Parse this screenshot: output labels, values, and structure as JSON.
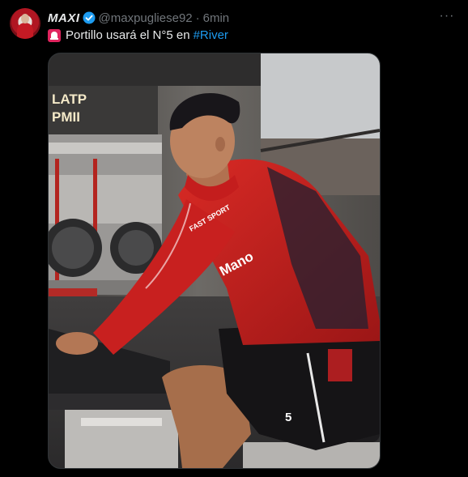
{
  "tweet": {
    "display_name": "MAXI",
    "handle": "@maxpugliese92",
    "separator": "·",
    "time": "6min",
    "text_main": "Portillo usará el N°5 en",
    "hashtag": "#River",
    "more_label": "···"
  },
  "media": {
    "gym_sign_top": "LATP",
    "gym_sign_bottom": "PMII",
    "jersey_sponsor": "Mano",
    "jersey_sleeve": "FAST SPORT",
    "shorts_number": "5"
  },
  "colors": {
    "background": "#000000",
    "text": "#e7e9ea",
    "muted": "#71767b",
    "link": "#1d9bf0",
    "verified": "#1d9bf0",
    "jersey_red": "#c8201f"
  }
}
